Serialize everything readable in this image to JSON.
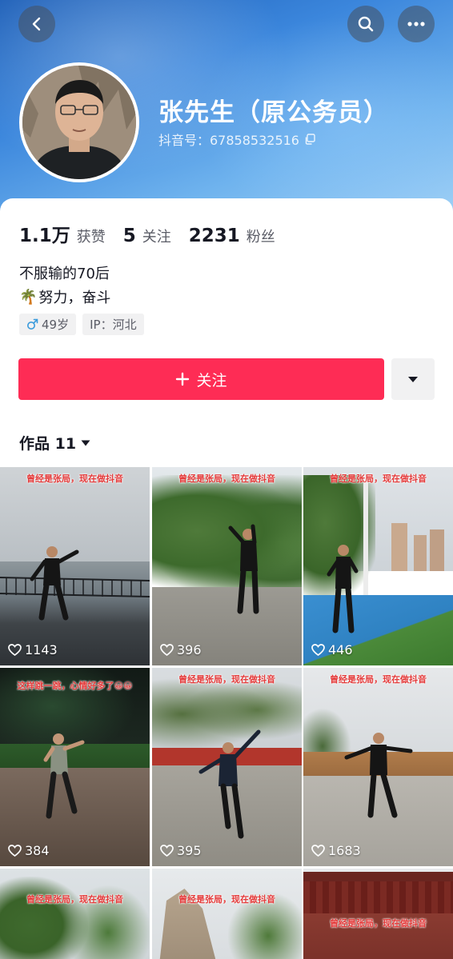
{
  "header": {
    "username": "张先生（原公务员）",
    "douyin_id": "抖音号：67858532516"
  },
  "stats": [
    {
      "value": "1.1万",
      "label": "获赞"
    },
    {
      "value": "5",
      "label": "关注"
    },
    {
      "value": "2231",
      "label": "粉丝"
    }
  ],
  "bio": {
    "line1": "不服输的70后",
    "line2_emoji": "🌴",
    "line2": "努力，奋斗"
  },
  "tags": {
    "age": "49岁",
    "ip": "IP：河北"
  },
  "follow_button": {
    "label": "关注",
    "color": "#fe2c55"
  },
  "works_tab": {
    "label": "作品 11"
  },
  "videos": [
    {
      "caption": "曾经是张局，现在做抖音",
      "likes": "1143"
    },
    {
      "caption": "曾经是张局，现在做抖音",
      "likes": "396"
    },
    {
      "caption": "曾经是张局，现在做抖音",
      "likes": "446"
    },
    {
      "caption": "这样跳一跳，心情好多了😀😀",
      "likes": "384"
    },
    {
      "caption": "曾经是张局，现在做抖音",
      "likes": "395"
    },
    {
      "caption": "曾经是张局，现在做抖音",
      "likes": "1683"
    },
    {
      "caption": "曾经是张局，现在做抖音",
      "likes": ""
    },
    {
      "caption": "曾经是张局，现在做抖音",
      "likes": ""
    },
    {
      "caption": "曾经是张局，现在做抖音",
      "likes": ""
    }
  ],
  "icons": {
    "back": "chevron-left-icon",
    "search": "search-icon",
    "more": "more-icon",
    "copy": "copy-icon",
    "male": "male-icon",
    "heart": "heart-icon"
  }
}
